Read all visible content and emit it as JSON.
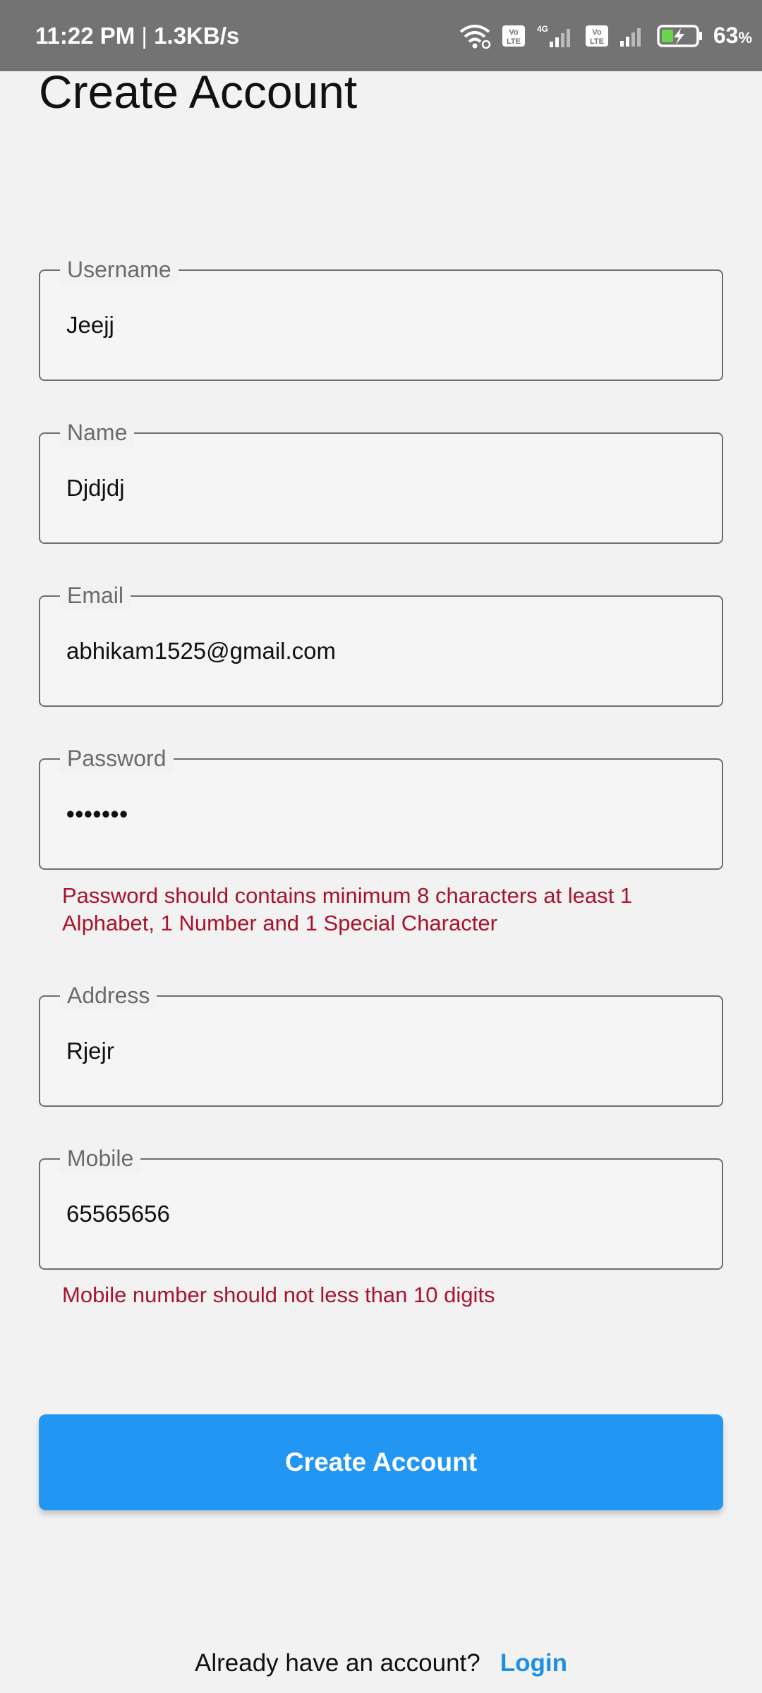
{
  "status_bar": {
    "time": "11:22 PM",
    "separator": "|",
    "speed": "1.3KB/s",
    "battery_level": "63",
    "battery_unit": "%",
    "icons": [
      "wifi-icon",
      "volte-icon",
      "signal-4g-icon",
      "volte-icon",
      "signal-icon",
      "battery-charging-icon"
    ],
    "volte_label": "Vo LTE",
    "network_label": "4G"
  },
  "page": {
    "title": "Create Account"
  },
  "form": {
    "username": {
      "label": "Username",
      "value": "Jeejj"
    },
    "name": {
      "label": "Name",
      "value": "Djdjdj"
    },
    "email": {
      "label": "Email",
      "value": "abhikam1525@gmail.com"
    },
    "password": {
      "label": "Password",
      "value": "•••••••",
      "error": "Password should contains minimum 8 characters at least 1 Alphabet, 1 Number and 1 Special Character"
    },
    "address": {
      "label": "Address",
      "value": "Rjejr"
    },
    "mobile": {
      "label": "Mobile",
      "value": "65565656",
      "error": "Mobile number should not less than 10 digits"
    },
    "submit_label": "Create Account"
  },
  "footer": {
    "prompt": "Already have an account?",
    "login_label": "Login"
  },
  "colors": {
    "status_bar": "#737373",
    "background": "#f2f2f2",
    "primary": "#2196f3",
    "error": "#a8132b",
    "link": "#1f8fe6"
  }
}
